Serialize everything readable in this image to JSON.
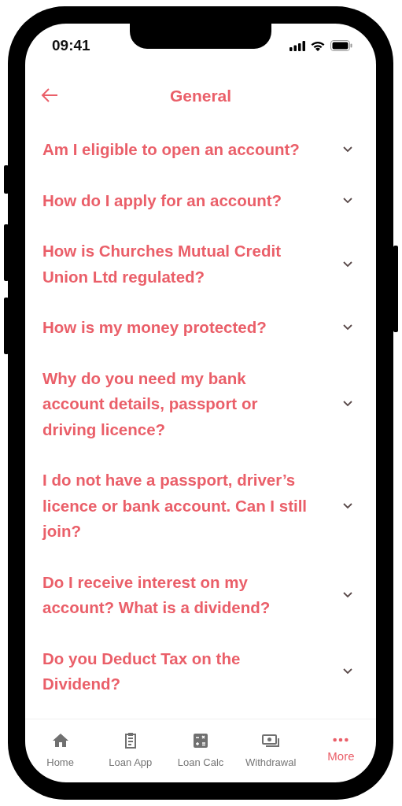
{
  "status_bar": {
    "time": "09:41"
  },
  "header": {
    "title": "General"
  },
  "faq": [
    {
      "question": "Am I eligible to open an account?",
      "expanded": false
    },
    {
      "question": "How do I apply for an account?",
      "expanded": false
    },
    {
      "question": "How is Churches Mutual Credit Union Ltd regulated?",
      "expanded": false
    },
    {
      "question": "How is my money protected?",
      "expanded": false
    },
    {
      "question": "Why do you need my bank account details, passport or driving licence?",
      "expanded": false
    },
    {
      "question": "I do not have a passport, driver’s licence or bank account. Can I still join?",
      "expanded": false
    },
    {
      "question": "Do I receive interest on my account? What is a dividend?",
      "expanded": false
    },
    {
      "question": "Do you Deduct Tax on the Dividend?",
      "expanded": false
    }
  ],
  "bottom_nav": [
    {
      "label": "Home",
      "selected": false
    },
    {
      "label": "Loan App",
      "selected": false
    },
    {
      "label": "Loan Calc",
      "selected": false
    },
    {
      "label": "Withdrawal",
      "selected": false
    },
    {
      "label": "More",
      "selected": true
    }
  ]
}
